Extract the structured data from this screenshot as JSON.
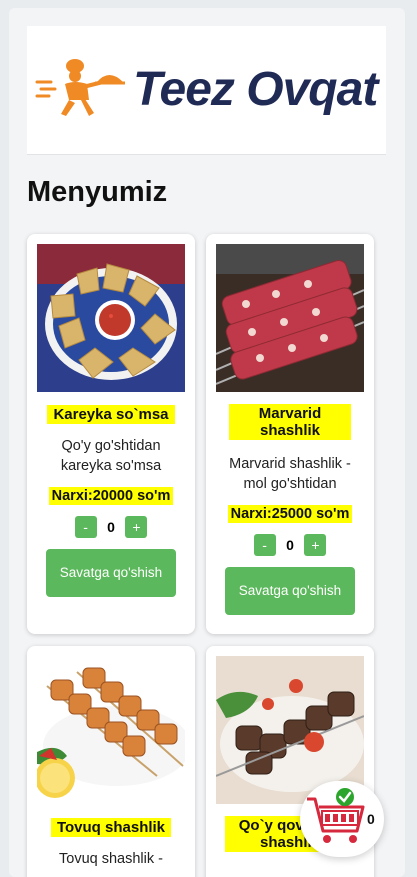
{
  "brand": {
    "name": "Teez Ovqat"
  },
  "section_title": "Menyumiz",
  "products": [
    {
      "name": "Kareyka so`msa",
      "description": "Qo'y go'shtidan kareyka so'msa",
      "price": "Narxi:20000 so'm",
      "qty": "0",
      "add_label": "Savatga qo'shish",
      "minus": "-",
      "plus": "+"
    },
    {
      "name": "Marvarid shashlik",
      "description": "Marvarid shashlik - mol go'shtidan",
      "price": "Narxi:25000 so'm",
      "qty": "0",
      "add_label": "Savatga qo'shish",
      "minus": "-",
      "plus": "+"
    },
    {
      "name": "Tovuq shashlik",
      "description": "Tovuq shashlik -",
      "price": "",
      "qty": "",
      "add_label": "",
      "minus": "-",
      "plus": "+"
    },
    {
      "name": "Qo`y qovurg`a shashlik",
      "description": "",
      "price": "",
      "qty": "",
      "add_label": "",
      "minus": "-",
      "plus": "+"
    }
  ],
  "cart": {
    "count": "0"
  },
  "colors": {
    "accent": "#5cb85c",
    "highlight": "#ffff00",
    "brand": "#1f2a55",
    "brand_orange": "#f08a24"
  }
}
